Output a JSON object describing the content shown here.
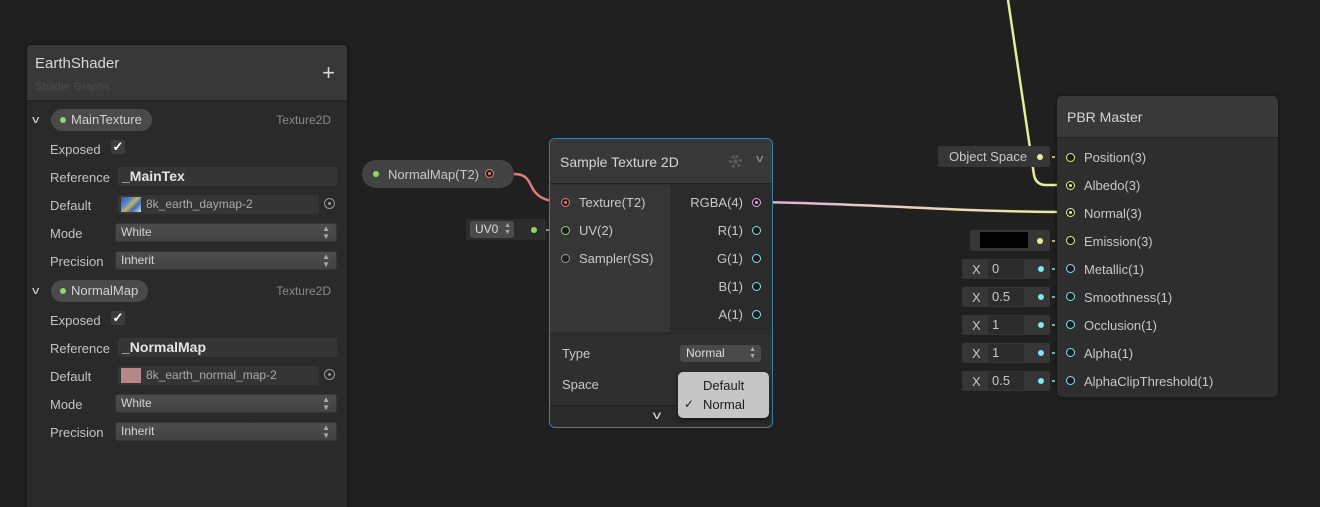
{
  "colors": {
    "texture_port": "#e07c7c",
    "vector2_port": "#8fd868",
    "vector4_port": "#e0a8e0",
    "vector3_port": "#e8eb9a",
    "vector1_port": "#84e4e7",
    "sampler_port": "#9a9a9a",
    "selection_border": "#3f7fa8"
  },
  "blackboard": {
    "title": "EarthShader",
    "subtitle": "Shader Graphs",
    "add_icon": "plus-icon",
    "properties": [
      {
        "name": "MainTexture",
        "type": "Texture2D",
        "exposed_label": "Exposed",
        "exposed": true,
        "reference_label": "Reference",
        "reference": "_MainTex",
        "default_label": "Default",
        "default": "8k_earth_daymap-2",
        "mode_label": "Mode",
        "mode": "White",
        "precision_label": "Precision",
        "precision": "Inherit"
      },
      {
        "name": "NormalMap",
        "type": "Texture2D",
        "exposed_label": "Exposed",
        "exposed": true,
        "reference_label": "Reference",
        "reference": "_NormalMap",
        "default_label": "Default",
        "default": "8k_earth_normal_map-2",
        "mode_label": "Mode",
        "mode": "White",
        "precision_label": "Precision",
        "precision": "Inherit"
      }
    ]
  },
  "property_node": {
    "label": "NormalMap(T2)"
  },
  "uv_input": {
    "value": "UV0"
  },
  "sample_texture_node": {
    "title": "Sample Texture 2D",
    "inputs": [
      "Texture(T2)",
      "UV(2)",
      "Sampler(SS)"
    ],
    "outputs": [
      "RGBA(4)",
      "R(1)",
      "G(1)",
      "B(1)",
      "A(1)"
    ],
    "type_label": "Type",
    "type_value": "Normal",
    "space_label": "Space",
    "space_dropdown": {
      "options": [
        "Default",
        "Normal"
      ],
      "selected": "Normal",
      "check_mark": "✓"
    }
  },
  "pbr_master_node": {
    "title": "PBR Master",
    "inputs": [
      "Position(3)",
      "Albedo(3)",
      "Normal(3)",
      "Emission(3)",
      "Metallic(1)",
      "Smoothness(1)",
      "Occlusion(1)",
      "Alpha(1)",
      "AlphaClipThreshold(1)"
    ],
    "position_default": "Object Space",
    "emission_default_color": "#000000",
    "vector1_defaults": [
      {
        "axis": "X",
        "value": "0"
      },
      {
        "axis": "X",
        "value": "0.5"
      },
      {
        "axis": "X",
        "value": "1"
      },
      {
        "axis": "X",
        "value": "1"
      },
      {
        "axis": "X",
        "value": "0.5"
      }
    ]
  }
}
